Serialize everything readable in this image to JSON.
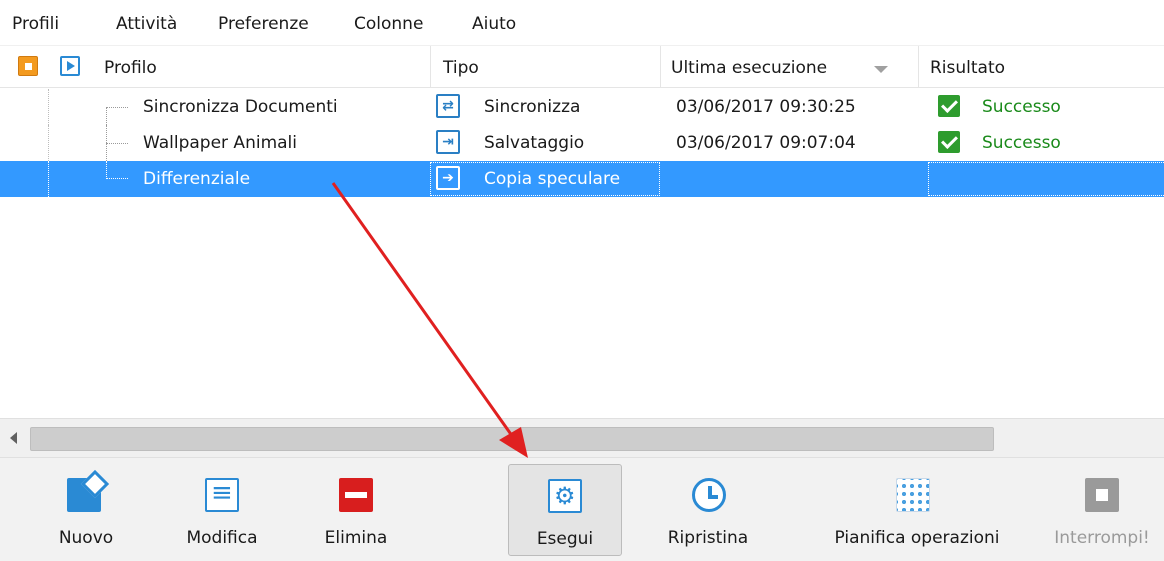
{
  "menu": {
    "items": [
      {
        "label": "Profili"
      },
      {
        "label": "Attività"
      },
      {
        "label": "Preferenze"
      },
      {
        "label": "Colonne"
      },
      {
        "label": "Aiuto"
      }
    ]
  },
  "list": {
    "columns": {
      "profile": "Profilo",
      "type": "Tipo",
      "last_run": "Ultima esecuzione",
      "result": "Risultato"
    },
    "rows": [
      {
        "name": "Sincronizza Documenti",
        "type": "Sincronizza",
        "type_icon": "sync-icon",
        "last_run": "03/06/2017 09:30:25",
        "result": "Successo"
      },
      {
        "name": "Wallpaper Animali",
        "type": "Salvataggio",
        "type_icon": "backup-icon",
        "last_run": "03/06/2017 09:07:04",
        "result": "Successo"
      },
      {
        "name": "Differenziale",
        "type": "Copia speculare",
        "type_icon": "mirror-icon",
        "last_run": "",
        "result": "",
        "selected": true
      }
    ]
  },
  "toolbar": {
    "new": "Nuovo",
    "edit": "Modifica",
    "delete": "Elimina",
    "run": "Esegui",
    "restore": "Ripristina",
    "schedule": "Pianifica operazioni",
    "stop": "Interrompi!"
  },
  "colors": {
    "selection": "#3399ff",
    "success": "#1a8a1a",
    "accent": "#2a8ad4",
    "annotation_arrow": "#e02020"
  }
}
